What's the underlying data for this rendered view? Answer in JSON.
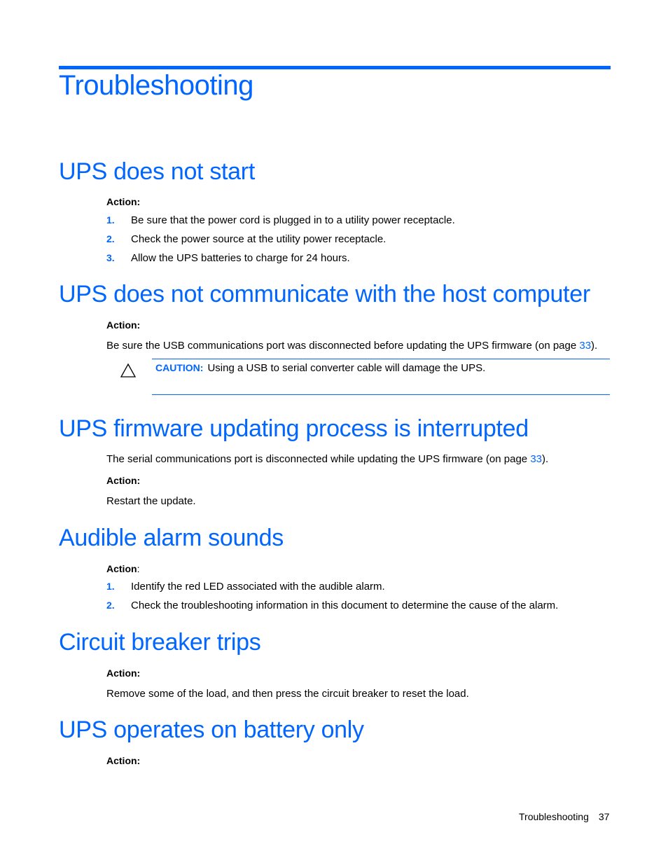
{
  "chapter_title": "Troubleshooting",
  "sections": [
    {
      "heading": "UPS does not start",
      "action_label": "Action:",
      "steps": [
        {
          "num": "1.",
          "text": "Be sure that the power cord is plugged in to a utility power receptacle."
        },
        {
          "num": "2.",
          "text": "Check the power source at the utility power receptacle."
        },
        {
          "num": "3.",
          "text": "Allow the UPS batteries to charge for 24 hours."
        }
      ]
    },
    {
      "heading": "UPS does not communicate with the host computer",
      "action_label": "Action:",
      "body_before_link": "Be sure the USB communications port was disconnected before updating the UPS firmware (on page ",
      "link": "33",
      "body_after_link": ").",
      "caution": {
        "icon": "warning-triangle-icon",
        "label": "CAUTION:",
        "text": "Using a USB to serial converter cable will damage the UPS."
      }
    },
    {
      "heading": "UPS firmware updating process is interrupted",
      "intro_before_link": "The serial communications port is disconnected while updating the UPS firmware (on page ",
      "link": "33",
      "intro_after_link": ").",
      "action_label": "Action:",
      "body": "Restart the update."
    },
    {
      "heading": "Audible alarm sounds",
      "action_label": "Action",
      "action_colon": ":",
      "steps": [
        {
          "num": "1.",
          "text": "Identify the red LED associated with the audible alarm."
        },
        {
          "num": "2.",
          "text": "Check the troubleshooting information in this document to determine the cause of the alarm."
        }
      ]
    },
    {
      "heading": "Circuit breaker trips",
      "action_label": "Action:",
      "body": "Remove some of the load, and then press the circuit breaker to reset the load."
    },
    {
      "heading": "UPS operates on battery only",
      "action_label": "Action:"
    }
  ],
  "footer": {
    "section": "Troubleshooting",
    "page_number": "37"
  },
  "colors": {
    "accent": "#0066ff",
    "text": "#000000"
  }
}
